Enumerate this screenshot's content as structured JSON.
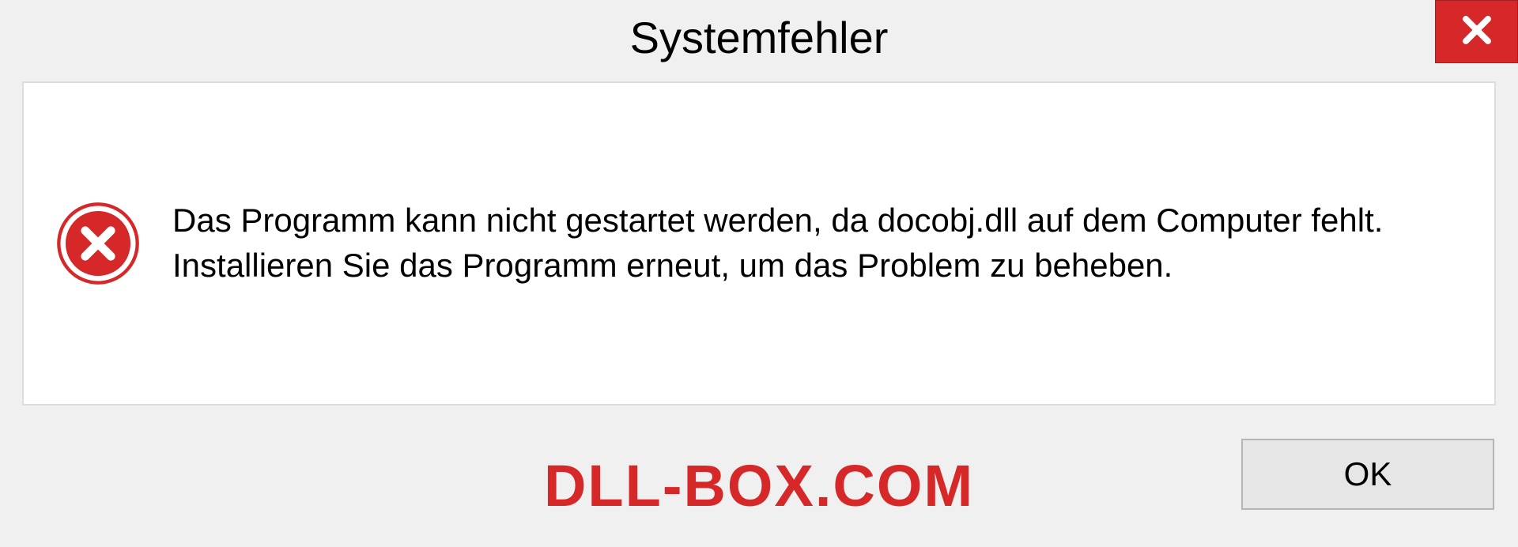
{
  "dialog": {
    "title": "Systemfehler",
    "message": "Das Programm kann nicht gestartet werden, da docobj.dll auf dem Computer fehlt. Installieren Sie das Programm erneut, um das Problem zu beheben.",
    "ok_label": "OK"
  },
  "watermark": "DLL-BOX.COM"
}
